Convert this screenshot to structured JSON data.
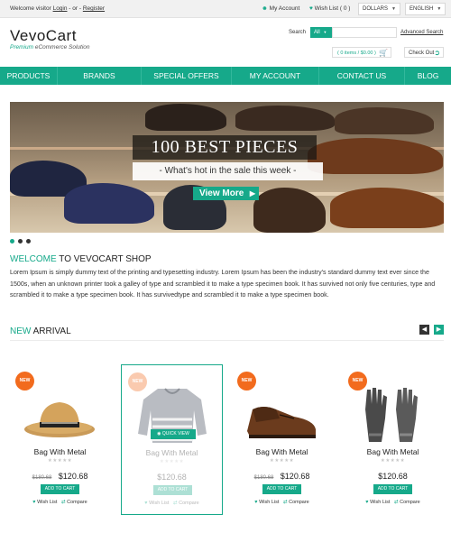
{
  "topbar": {
    "welcome_prefix": "Welcome visitor",
    "login": "Login",
    "or": "- or -",
    "register": "Register",
    "my_account": "My Account",
    "wishlist": "Wish List ( 0 )",
    "currency": "DOLLARS",
    "language": "ENGLISH"
  },
  "header": {
    "logo": "VevoCart",
    "tagline_accent": "Premium",
    "tagline_rest": "eCommerce Solution",
    "search_label": "Search",
    "search_category": "All",
    "search_placeholder": "",
    "advanced_search": "Advanced Search",
    "cart_summary": "( 0 items / $0.00 )",
    "checkout": "Check Out"
  },
  "nav": [
    "PRODUCTS",
    "BRANDS",
    "SPECIAL OFFERS",
    "MY ACCOUNT",
    "CONTACT US",
    "BLOG"
  ],
  "hero": {
    "title": "100 BEST PIECES",
    "subtitle": "- What's hot in the sale this week -",
    "button": "View More"
  },
  "slider": {
    "total": 3,
    "active_index": 0
  },
  "welcome": {
    "title_accent": "WELCOME",
    "title_rest": "TO VEVOCART SHOP",
    "text": "Lorem Ipsum is simply dummy text of the printing and typesetting industry. Lorem Ipsum has been the industry's standard dummy text ever since the 1500s, when an unknown printer took a galley of type and scrambled it to make a type specimen book. It has survived not only five centuries,  type and scrambled it to make a type specimen book. It has survivedtype and scrambled it to make a type specimen book."
  },
  "new_arrival": {
    "title_accent": "NEW",
    "title_rest": "ARRIVAL",
    "quick_view": "QUICK VIEW",
    "products": [
      {
        "badge": "NEW",
        "name": "Bag With Metal",
        "old_price": "$180.68",
        "price": "$120.68",
        "add_to_cart": "ADD TO CART",
        "wishlist": "Wish List",
        "compare": "Compare",
        "image": "hat"
      },
      {
        "badge": "NEW",
        "name": "Bag With Metal",
        "old_price": "",
        "price": "$120.68",
        "add_to_cart": "ADD TO CART",
        "wishlist": "Wish List",
        "compare": "Compare",
        "image": "sweater"
      },
      {
        "badge": "NEW",
        "name": "Bag With Metal",
        "old_price": "$180.68",
        "price": "$120.68",
        "add_to_cart": "ADD TO CART",
        "wishlist": "Wish List",
        "compare": "Compare",
        "image": "shoe"
      },
      {
        "badge": "NEW",
        "name": "Bag With Metal",
        "old_price": "",
        "price": "$120.68",
        "add_to_cart": "ADD TO CART",
        "wishlist": "Wish List",
        "compare": "Compare",
        "image": "gloves"
      }
    ]
  },
  "colors": {
    "accent": "#16a98a",
    "badge": "#f26b1d"
  }
}
